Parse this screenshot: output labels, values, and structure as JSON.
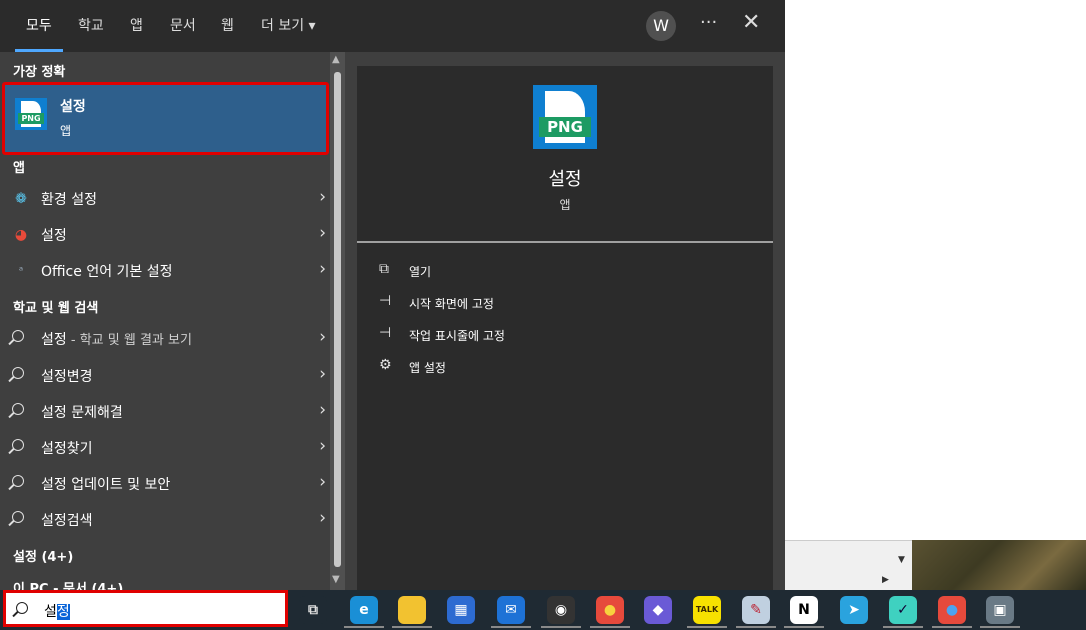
{
  "tabs": [
    "모두",
    "학교",
    "앱",
    "문서",
    "웹",
    "더 보기 ▾"
  ],
  "account_initial": "W",
  "more_label": "···",
  "close_label": "✕",
  "sections": {
    "best": "가장 정확",
    "apps": "앱",
    "web": "학교 및 웹 검색",
    "settings": "설정 (4+)",
    "docs": "이 PC - 문서 (4+)"
  },
  "best_match": {
    "title": "설정",
    "subtitle": "앱",
    "icon_text": "PNG"
  },
  "apps": [
    {
      "label": "환경 설정",
      "icon": "gear-blue-icon"
    },
    {
      "label": "설정",
      "icon": "palette-icon"
    },
    {
      "label": "Office 언어 기본 설정",
      "icon": "office-language-icon"
    }
  ],
  "web_results": [
    {
      "label": "설정",
      "suffix": " - 학교 및 웹 결과 보기"
    },
    {
      "label": "설정변경",
      "suffix": ""
    },
    {
      "label": "설정 문제해결",
      "suffix": ""
    },
    {
      "label": "설정찾기",
      "suffix": ""
    },
    {
      "label": "설정 업데이트 및 보안",
      "suffix": ""
    },
    {
      "label": "설정검색",
      "suffix": ""
    }
  ],
  "detail": {
    "title": "설정",
    "subtitle": "앱",
    "icon_text": "PNG"
  },
  "actions": [
    {
      "label": "열기",
      "icon": "open-icon"
    },
    {
      "label": "시작 화면에 고정",
      "icon": "pin-icon"
    },
    {
      "label": "작업 표시줄에 고정",
      "icon": "pin-icon"
    },
    {
      "label": "앱 설정",
      "icon": "gear-icon"
    }
  ],
  "search": {
    "typed_prefix": "설",
    "selected": "정"
  },
  "taskbar_apps": [
    {
      "name": "task-view-icon",
      "text": "⧉",
      "color": "#1f2a33",
      "fg": "#ddd"
    },
    {
      "name": "edge-icon",
      "text": "e",
      "color": "#1a8fd6",
      "fg": "#fff"
    },
    {
      "name": "file-explorer-icon",
      "text": "",
      "color": "#f2c230",
      "fg": "#000"
    },
    {
      "name": "store-icon",
      "text": "▦",
      "color": "#2d6bd1",
      "fg": "#fff"
    },
    {
      "name": "mail-icon",
      "text": "✉",
      "color": "#1e72d6",
      "fg": "#fff"
    },
    {
      "name": "obs-icon",
      "text": "◉",
      "color": "#333",
      "fg": "#fff"
    },
    {
      "name": "chrome-icon",
      "text": "●",
      "color": "#e64a3c",
      "fg": "#f7d23e"
    },
    {
      "name": "copilot-icon",
      "text": "◆",
      "color": "#6a5ad6",
      "fg": "#fff"
    },
    {
      "name": "kakaotalk-icon",
      "text": "TALK",
      "color": "#f7e100",
      "fg": "#3a2a00"
    },
    {
      "name": "paint-icon",
      "text": "✎",
      "color": "#c0d0e0",
      "fg": "#b23"
    },
    {
      "name": "notion-icon",
      "text": "N",
      "color": "#fff",
      "fg": "#000"
    },
    {
      "name": "telegram-icon",
      "text": "➤",
      "color": "#2aa3de",
      "fg": "#fff"
    },
    {
      "name": "bird-app-icon",
      "text": "✓",
      "color": "#3fd1c0",
      "fg": "#103"
    },
    {
      "name": "chrome-profile-icon",
      "text": "●",
      "color": "#e64a3c",
      "fg": "#4ca3f0"
    },
    {
      "name": "network-icon",
      "text": "▣",
      "color": "#6a7a86",
      "fg": "#fff"
    }
  ]
}
